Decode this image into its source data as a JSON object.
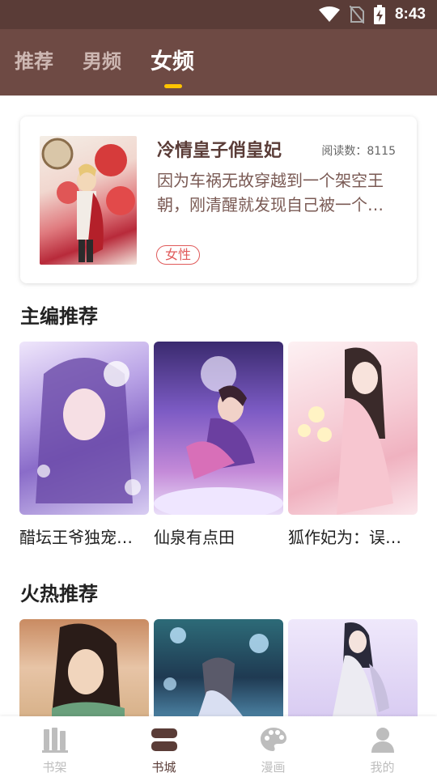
{
  "status_bar": {
    "time": "8:43"
  },
  "tabs": [
    {
      "label": "推荐",
      "active": false
    },
    {
      "label": "男频",
      "active": false
    },
    {
      "label": "女频",
      "active": true
    }
  ],
  "featured": {
    "title": "冷情皇子俏皇妃",
    "reads": "阅读数：8115",
    "description": "因为车祸无故穿越到一个架空王朝，刚清醒就发现自己被一个…",
    "tag": "女性"
  },
  "editor_picks": {
    "title": "主编推荐",
    "books": [
      {
        "title": "醋坛王爷独宠…"
      },
      {
        "title": "仙泉有点田"
      },
      {
        "title": "狐作妃为：误…"
      }
    ]
  },
  "hot_picks": {
    "title": "火热推荐"
  },
  "bottom_nav": [
    {
      "label": "书架",
      "icon": "bookshelf-icon",
      "active": false
    },
    {
      "label": "书城",
      "icon": "bookstore-icon",
      "active": true
    },
    {
      "label": "漫画",
      "icon": "comic-palette-icon",
      "active": false
    },
    {
      "label": "我的",
      "icon": "profile-icon",
      "active": false
    }
  ],
  "colors": {
    "app_bar": "#6e4a44",
    "status_bar": "#5a3c37",
    "indicator": "#ffc400",
    "tag": "#e05a5a",
    "nav_active": "#5a3c37",
    "nav_inactive": "#bdbdbd"
  }
}
